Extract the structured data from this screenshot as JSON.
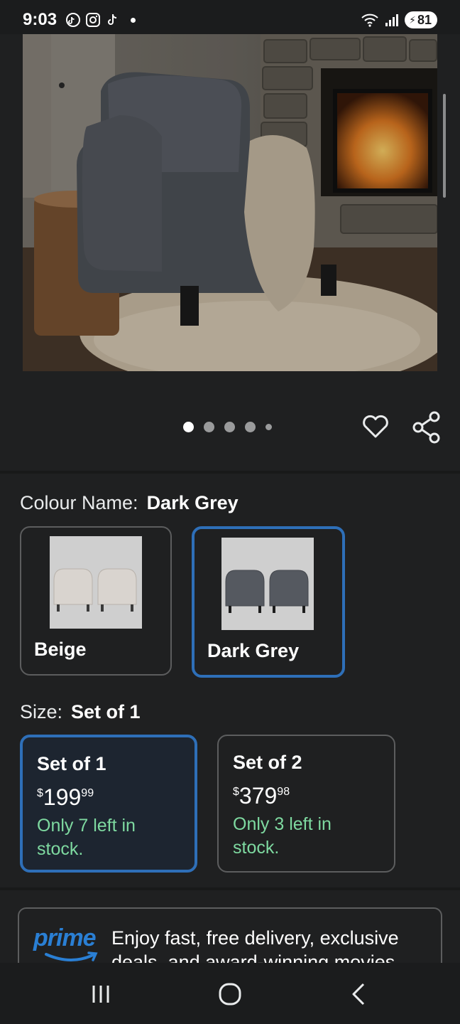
{
  "status": {
    "time": "9:03",
    "battery": "81",
    "icons_left": [
      "tiktok-icon",
      "instagram-icon",
      "tiktok-icon"
    ],
    "icons_right": [
      "wifi-icon",
      "signal-icon"
    ]
  },
  "gallery": {
    "image": "Dark grey armchair beside a stone fireplace",
    "page_count": 5,
    "active_index": 0
  },
  "colour": {
    "label": "Colour Name:",
    "selected": "Dark Grey",
    "options": [
      {
        "name": "Beige",
        "selected": false,
        "color": "#d9d4cf"
      },
      {
        "name": "Dark Grey",
        "selected": true,
        "color": "#5b5e63"
      }
    ]
  },
  "size": {
    "label": "Size:",
    "selected": "Set of 1",
    "options": [
      {
        "name": "Set of 1",
        "currency": "$",
        "price_whole": "199",
        "price_fraction": "99",
        "stock": "Only 7 left in stock.",
        "selected": true
      },
      {
        "name": "Set of 2",
        "currency": "$",
        "price_whole": "379",
        "price_fraction": "98",
        "stock": "Only 3 left in stock.",
        "selected": false
      }
    ]
  },
  "prime": {
    "logo": "prime",
    "text": "Enjoy fast, free delivery, exclusive deals, and award-winning movies"
  },
  "nav": {
    "buttons": [
      "recents-icon",
      "home-icon",
      "back-icon"
    ]
  },
  "colors": {
    "accent": "#2e6fb8",
    "stock_green": "#7ed9a0",
    "prime_blue": "#2a7fd4",
    "background": "#1f2021"
  }
}
